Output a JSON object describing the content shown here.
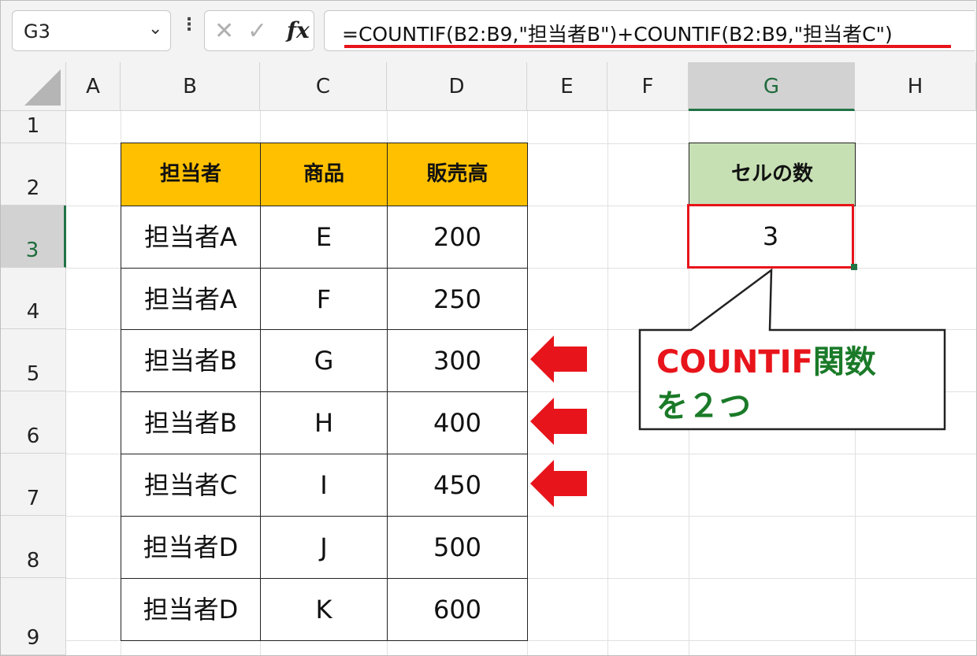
{
  "formula_bar": {
    "name_box": "G3",
    "cancel_icon": "✕",
    "enter_icon": "✓",
    "fx_label": "fx",
    "formula": "=COUNTIF(B2:B9,\"担当者B\")+COUNTIF(B2:B9,\"担当者C\")"
  },
  "columns": [
    "A",
    "B",
    "C",
    "D",
    "E",
    "F",
    "G",
    "H"
  ],
  "selected_column": "G",
  "rows": [
    "1",
    "2",
    "3",
    "4",
    "5",
    "6",
    "7",
    "8",
    "9"
  ],
  "selected_row": "3",
  "table": {
    "headers": [
      "担当者",
      "商品",
      "販売高"
    ],
    "rows": [
      [
        "担当者A",
        "E",
        "200"
      ],
      [
        "担当者A",
        "F",
        "250"
      ],
      [
        "担当者B",
        "G",
        "300"
      ],
      [
        "担当者B",
        "H",
        "400"
      ],
      [
        "担当者C",
        "I",
        "450"
      ],
      [
        "担当者D",
        "J",
        "500"
      ],
      [
        "担当者D",
        "K",
        "600"
      ]
    ]
  },
  "result": {
    "header": "セルの数",
    "value": "3"
  },
  "callout": {
    "line1_red": "COUNTIF",
    "line1_green": "関数",
    "line2": "を２つ"
  },
  "colors": {
    "header_fill": "#ffc000",
    "result_header_fill": "#c6e0b4",
    "highlight_red": "#e8141b",
    "callout_green": "#1a7a28",
    "excel_green": "#217346"
  }
}
